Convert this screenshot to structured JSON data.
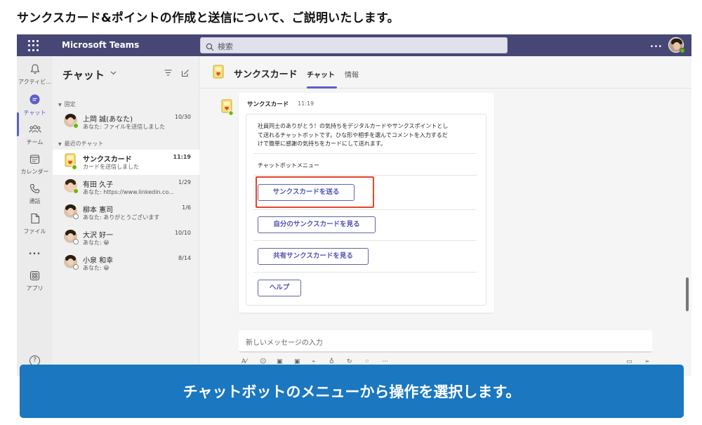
{
  "headline": "サンクスカード&ポイントの作成と送信について、ご説明いたします。",
  "topbar": {
    "app_title": "Microsoft Teams",
    "search_placeholder": "検索",
    "more": "..."
  },
  "rail": {
    "items": [
      {
        "label": "アクティビ...",
        "icon": "bell-icon"
      },
      {
        "label": "チャット",
        "icon": "chat-icon"
      },
      {
        "label": "チーム",
        "icon": "teams-icon"
      },
      {
        "label": "カレンダー",
        "icon": "calendar-icon"
      },
      {
        "label": "通話",
        "icon": "phone-icon"
      },
      {
        "label": "ファイル",
        "icon": "file-icon"
      },
      {
        "label": "...",
        "icon": "more-icon"
      },
      {
        "label": "アプリ",
        "icon": "apps-icon"
      }
    ],
    "help": "?"
  },
  "chatlist": {
    "title": "チャット",
    "pinned_label": "固定",
    "recent_label": "最近のチャット",
    "pinned": [
      {
        "name": "上岡 誠(あなた)",
        "time": "10/30",
        "preview": "あなた: ファイルを送信しました",
        "status": "available"
      }
    ],
    "recent": [
      {
        "name": "サンクスカード",
        "time": "11:19",
        "preview": "カードを送信しました",
        "status": "available",
        "selected": true
      },
      {
        "name": "有田 久子",
        "time": "1/29",
        "preview": "あなた: https://www.linkedin.co...",
        "status": "available"
      },
      {
        "name": "柳本 憲司",
        "time": "1/6",
        "preview": "あなた: ありがとうございます",
        "status": "offline"
      },
      {
        "name": "大沢 好一",
        "time": "10/10",
        "preview": "あなた: 😀",
        "status": "offline"
      },
      {
        "name": "小泉 和幸",
        "time": "8/14",
        "preview": "あなた: 😀",
        "status": "offline"
      }
    ]
  },
  "main": {
    "title": "サンクスカード",
    "tabs": [
      "チャット",
      "情報"
    ],
    "message": {
      "sender": "サンクスカード",
      "time": "11:19",
      "description_lines": [
        "社員同士のありがとう！の気持ちをデジタルカードやサンクスポイントとし",
        "て送れるチャットボットです。ひな形や相手を選んでコメントを入力するだ",
        "けで簡単に感謝の気持ちをカードにして送れます。"
      ],
      "menu_label": "チャットボットメニュー",
      "buttons": [
        "サンクスカードを送る",
        "自分のサンクスカードを見る",
        "共有サンクスカードを見る",
        "ヘルプ"
      ]
    },
    "composer_placeholder": "新しいメッセージの入力"
  },
  "banner": "チャットボットのメニューから操作を選択します。",
  "colors": {
    "topbar": "#464775",
    "accent": "#5b5fc7",
    "highlight": "#e8432a",
    "banner": "#1a77c0",
    "available": "#6bb700"
  }
}
